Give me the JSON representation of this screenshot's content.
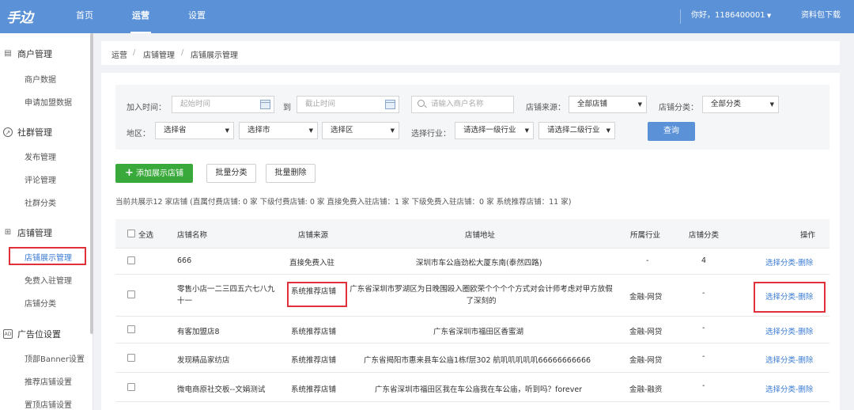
{
  "topbar": {
    "logo": "手边",
    "nav": [
      "首页",
      "运营",
      "设置"
    ],
    "greeting": "你好，1186400001",
    "download": "资料包下载"
  },
  "sidebar": {
    "groups": [
      {
        "label": "商户管理",
        "icon": "calendar-icon",
        "items": [
          "商户数据",
          "申请加盟数据"
        ]
      },
      {
        "label": "社群管理",
        "icon": "compass-icon",
        "items": [
          "发布管理",
          "评论管理",
          "社群分类"
        ]
      },
      {
        "label": "店铺管理",
        "icon": "grid-icon",
        "items": [
          "店铺展示管理",
          "免费入驻管理",
          "店铺分类"
        ]
      },
      {
        "label": "广告位设置",
        "icon": "ad-icon",
        "items": [
          "顶部Banner设置",
          "推荐店铺设置",
          "置顶店铺设置"
        ]
      }
    ]
  },
  "breadcrumb": [
    "运营",
    "店铺管理",
    "店铺展示管理"
  ],
  "filters": {
    "join_time_label": "加入时间：",
    "start_placeholder": "起始时间",
    "to": "到",
    "end_placeholder": "截止时间",
    "search_placeholder": "请输入商户名称",
    "source_label": "店铺来源：",
    "source_value": "全部店铺",
    "category_label": "店铺分类：",
    "category_value": "全部分类",
    "region_label": "地区：",
    "province": "选择省",
    "city": "选择市",
    "district": "选择区",
    "industry_label": "选择行业：",
    "industry1": "请选择一级行业",
    "industry2": "请选择二级行业",
    "query": "查询"
  },
  "actions": {
    "add": "添加展示店铺",
    "batch_category": "批量分类",
    "batch_delete": "批量删除"
  },
  "summary": "当前共展示12 家店铺 (直属付费店铺: 0 家   下级付费店铺: 0 家   直接免费入驻店铺：1 家 下级免费入驻店铺：0 家 系统推荐店铺：11 家)",
  "table": {
    "headers": [
      "全选",
      "店铺名称",
      "店铺来源",
      "店铺地址",
      "所属行业",
      "店铺分类",
      "操作"
    ],
    "rows": [
      {
        "name": "666",
        "source": "直接免费入驻",
        "address": "深圳市车公庙劲松大厦东南(泰然四路)",
        "industry": "-",
        "category": "4",
        "op": "选择分类-删除"
      },
      {
        "name": "零售小店一二三四五六七八九十一",
        "source": "系统推荐店铺",
        "address": "广东省深圳市罗湖区为日晚围殴入圈欧荣个个个个方式对会计师考虑对甲方放假了深刻的",
        "industry": "金融-网贷",
        "category": "-",
        "op": "选择分类-删除"
      },
      {
        "name": "有客加盟店8",
        "source": "系统推荐店铺",
        "address": "广东省深圳市福田区香蜜湖",
        "industry": "金融-网贷",
        "category": "-",
        "op": "选择分类-删除"
      },
      {
        "name": "发现精品家纺店",
        "source": "系统推荐店铺",
        "address": "广东省揭阳市惠来县车公庙1栋f层302 航叽叽叽叽叽66666666666",
        "industry": "金融-网贷",
        "category": "-",
        "op": "选择分类-删除"
      },
      {
        "name": "微电商原社交板--文娟测试",
        "source": "系统推荐店铺",
        "address": "广东省深圳市福田区我在车公庙我在车公庙，听到吗？forever",
        "industry": "金融-融资",
        "category": "-",
        "op": "选择分类-删除"
      }
    ]
  },
  "colors": {
    "primary": "#5b91d6",
    "success": "#39a93b",
    "highlight": "#e0303a",
    "link": "#3a7bd5"
  }
}
